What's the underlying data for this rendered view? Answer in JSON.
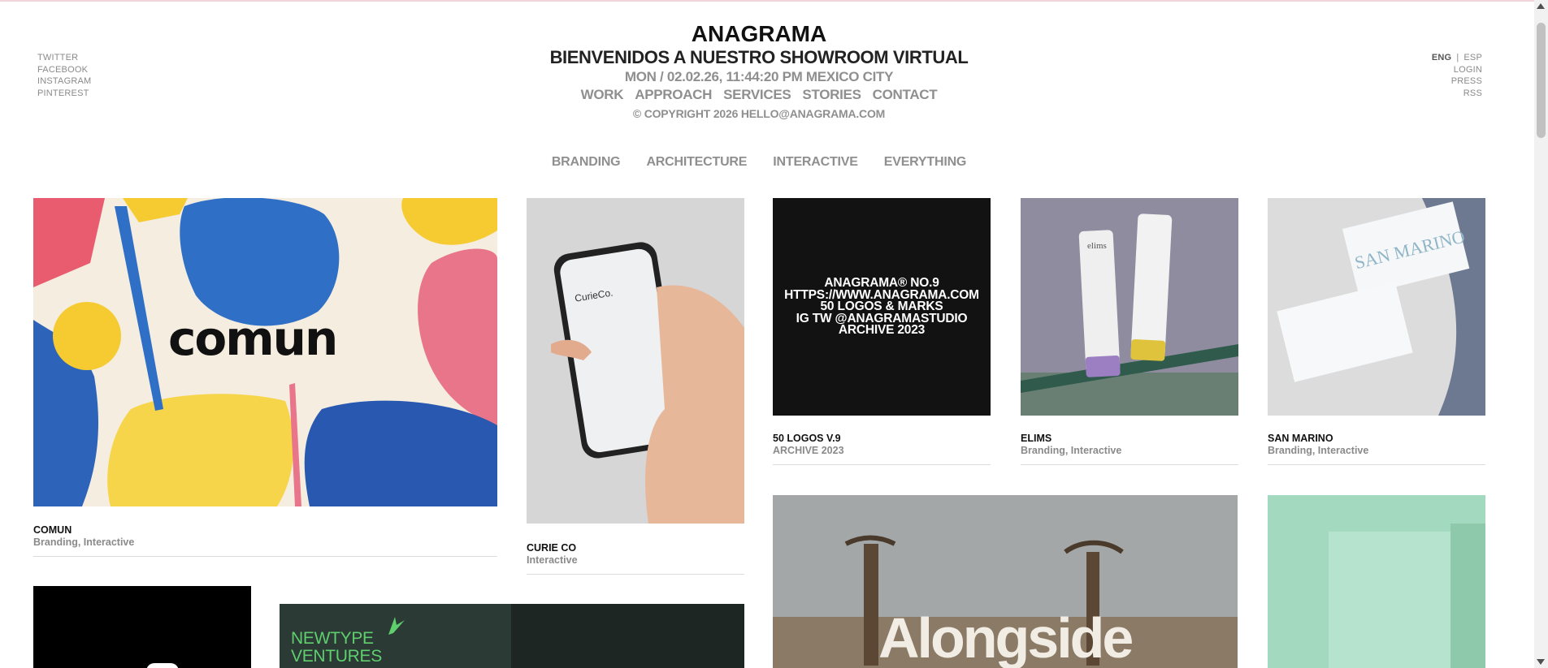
{
  "header": {
    "brand": "ANAGRAMA",
    "welcome": "BIENVENIDOS A NUESTRO SHOWROOM VIRTUAL",
    "clock": "MON / 02.02.26, 11:44:20 PM MEXICO CITY",
    "nav": [
      "WORK",
      "APPROACH",
      "SERVICES",
      "STORIES",
      "CONTACT"
    ],
    "copyright": "© COPYRIGHT 2026 HELLO@ANAGRAMA.COM"
  },
  "social": [
    "TWITTER",
    "FACEBOOK",
    "INSTAGRAM",
    "PINTEREST"
  ],
  "right_nav": {
    "lang_active": "ENG",
    "lang_separator": "|",
    "lang_other": "ESP",
    "links": [
      "LOGIN",
      "PRESS",
      "RSS"
    ]
  },
  "filters": [
    "BRANDING",
    "ARCHITECTURE",
    "INTERACTIVE",
    "EVERYTHING"
  ],
  "projects": [
    {
      "title": "COMUN",
      "tags": "Branding, Interactive",
      "image_text": "comun"
    },
    {
      "title": "CURIE CO",
      "tags": "Interactive",
      "image_text": "CurieCo."
    },
    {
      "title": "50 LOGOS V.9",
      "tags": "ARCHIVE 2023",
      "image_text": [
        "ANAGRAMA® NO.9",
        "HTTPS://WWW.ANAGRAMA.COM",
        "50 LOGOS & MARKS",
        "IG TW @ANAGRAMASTUDIO",
        "ARCHIVE 2023"
      ]
    },
    {
      "title": "ELIMS",
      "tags": "Branding, Interactive",
      "image_text": "elims"
    },
    {
      "title": "SAN MARINO",
      "tags": "Branding, Interactive",
      "image_text": "SAN MARINO"
    }
  ],
  "partial_tiles": {
    "newtype": [
      "NEWTYPE",
      "VENTURES"
    ],
    "alongside": "Alongside"
  },
  "colors": {
    "background": "#ffffff",
    "muted_text": "#8f8f8f",
    "newtype_green": "#5fcf6e",
    "newtype_dark": "#2b3a35",
    "mint": "#9fd8bd"
  }
}
